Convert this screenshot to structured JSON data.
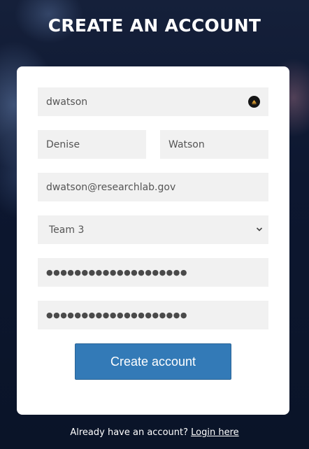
{
  "header": {
    "title": "CREATE AN ACCOUNT"
  },
  "form": {
    "username": "dwatson",
    "first_name": "Denise",
    "last_name": "Watson",
    "email": "dwatson@researchlab.gov",
    "team": "Team 3",
    "password_mask": "●●●●●●●●●●●●●●●●●●●●",
    "confirm_password_mask": "●●●●●●●●●●●●●●●●●●●●",
    "submit_label": "Create account"
  },
  "footer": {
    "prompt": "Already have an account?",
    "login_link": "Login here"
  },
  "colors": {
    "button": "#337ab7",
    "field_bg": "#f1f1f1",
    "card_bg": "#ffffff"
  },
  "icons": {
    "username_field": "password-manager-icon",
    "team_select": "chevron-down-icon"
  }
}
